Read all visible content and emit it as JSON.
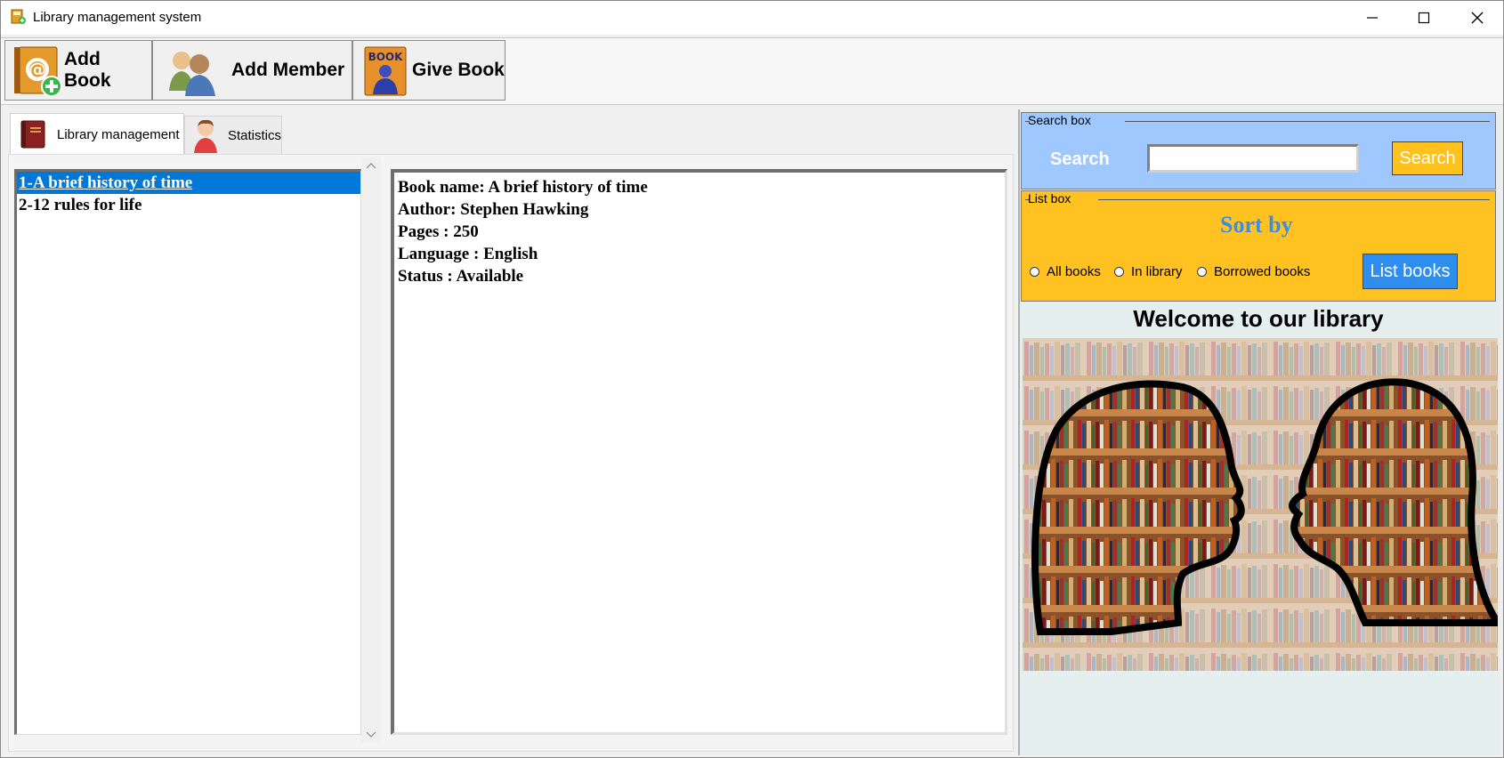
{
  "window": {
    "title": "Library management system"
  },
  "toolbar": {
    "add_book": "Add Book",
    "add_member": "Add Member",
    "give_book": "Give Book"
  },
  "tabs": {
    "library": "Library management",
    "statistics": "Statistics"
  },
  "books_list": [
    "1-A brief history of time",
    "2-12 rules for life"
  ],
  "details": {
    "book_name": "Book name: A brief history of time",
    "author": "Author: Stephen Hawking",
    "pages": "Pages : 250",
    "language": "Language : English",
    "status": "Status : Available"
  },
  "search": {
    "group_title": "Search box",
    "label": "Search",
    "input_value": "",
    "button": "Search"
  },
  "list_box": {
    "group_title": "List box",
    "sort_by": "Sort by",
    "options": [
      "All books",
      "In library",
      "Borrowed books"
    ],
    "button": "List books"
  },
  "welcome": "Welcome to our library",
  "colors": {
    "selection": "#0078d7",
    "search_panel": "#9ec8ff",
    "list_panel": "#ffc220",
    "search_button": "#ffc21c",
    "list_button": "#2d8ef0",
    "sort_by_text": "#3a8ee6"
  }
}
